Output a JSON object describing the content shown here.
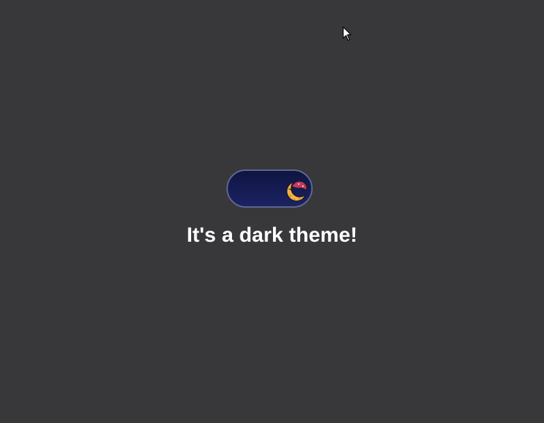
{
  "theme": {
    "toggle_state": "dark",
    "heading": "It's a dark theme!"
  },
  "icons": {
    "toggle_knob": "moon-icon",
    "cursor": "cursor-arrow-icon"
  },
  "colors": {
    "background": "#38383a",
    "toggle_border": "#5d6a92",
    "toggle_track_top": "#0f1540",
    "toggle_track_bottom": "#1c2263",
    "moon": "#f2b545",
    "cap": "#c23a5e",
    "heading": "#ffffff"
  }
}
